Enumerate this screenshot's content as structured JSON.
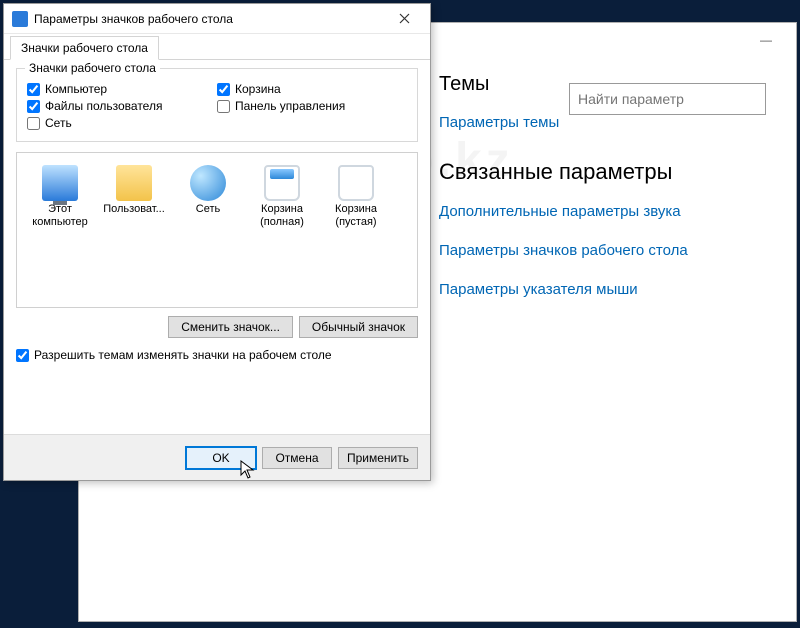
{
  "dialog": {
    "title": "Параметры значков рабочего стола",
    "tab": "Значки рабочего стола",
    "groupbox_legend": "Значки рабочего стола",
    "checkboxes": {
      "col1": [
        {
          "label": "Компьютер",
          "checked": true
        },
        {
          "label": "Файлы пользователя",
          "checked": true
        },
        {
          "label": "Сеть",
          "checked": false
        }
      ],
      "col2": [
        {
          "label": "Корзина",
          "checked": true
        },
        {
          "label": "Панель управления",
          "checked": false
        }
      ]
    },
    "icons": [
      {
        "label1": "Этот",
        "label2": "компьютер",
        "kind": "computer",
        "selected": false
      },
      {
        "label1": "Пользоват...",
        "label2": "",
        "kind": "folder",
        "selected": false
      },
      {
        "label1": "Сеть",
        "label2": "",
        "kind": "network",
        "selected": false
      },
      {
        "label1": "Корзина",
        "label2": "(полная)",
        "kind": "bin-full",
        "selected": false
      },
      {
        "label1": "Корзина",
        "label2": "(пустая)",
        "kind": "bin-empty",
        "selected": false
      }
    ],
    "btn_change": "Сменить значок...",
    "btn_default": "Обычный значок",
    "allow_themes_label": "Разрешить темам изменять значки на рабочем столе",
    "allow_themes_checked": true,
    "btn_ok": "OK",
    "btn_cancel": "Отмена",
    "btn_apply": "Применить"
  },
  "settings": {
    "search_placeholder": "Найти параметр",
    "themes_heading": "Темы",
    "themes_link": "Параметры темы",
    "related_heading": "Связанные параметры",
    "link_sound": "Дополнительные параметры звука",
    "link_icons": "Параметры значков рабочего стола",
    "link_mouse": "Параметры указателя мыши"
  },
  "watermark": "Mhelp.kz"
}
